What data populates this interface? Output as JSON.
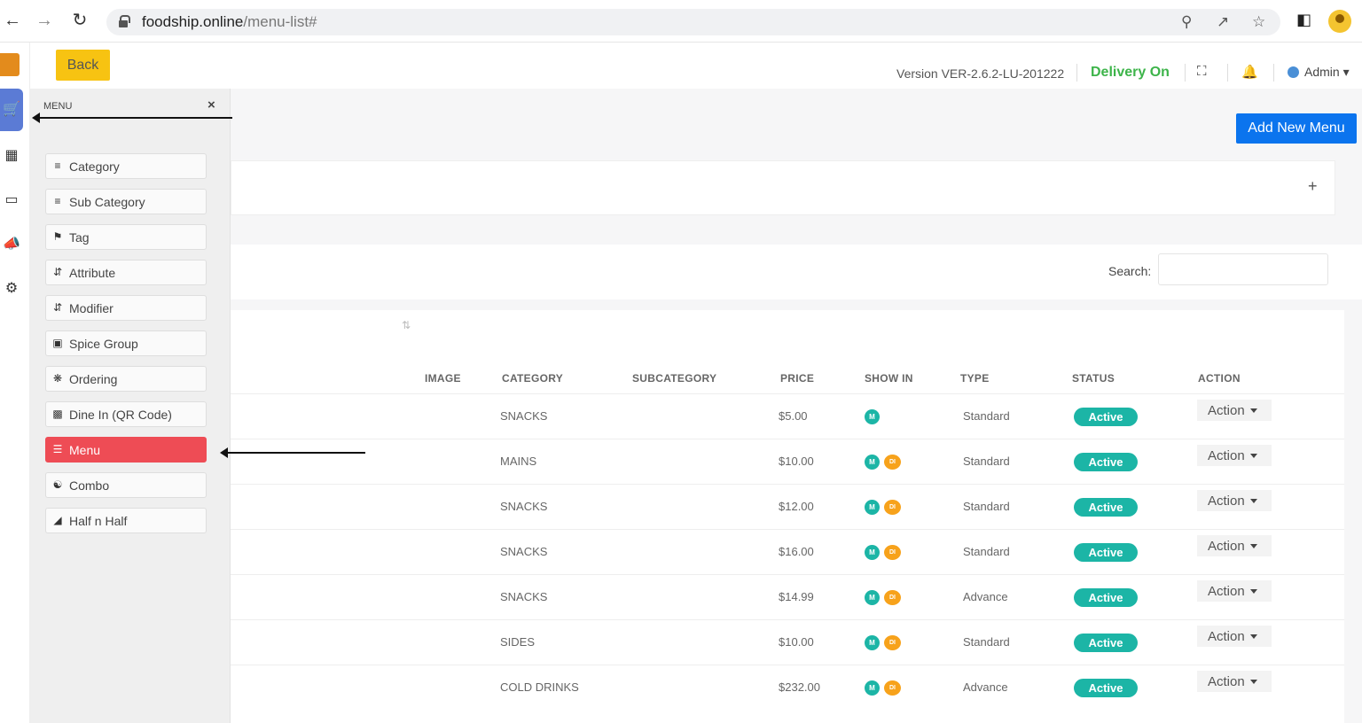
{
  "browser": {
    "url_host": "foodship.online",
    "url_path": "/menu-list#"
  },
  "header": {
    "back_label": "Back",
    "version": "Version VER-2.6.2-LU-201222",
    "delivery": "Delivery On",
    "admin": "Admin"
  },
  "menu_panel": {
    "title": "MENU",
    "close": "×",
    "items": [
      {
        "label": "Category",
        "icon": "list-icon"
      },
      {
        "label": "Sub Category",
        "icon": "list-icon"
      },
      {
        "label": "Tag",
        "icon": "tag-icon"
      },
      {
        "label": "Attribute",
        "icon": "sort-icon"
      },
      {
        "label": "Modifier",
        "icon": "sort-icon"
      },
      {
        "label": "Spice Group",
        "icon": "image-icon"
      },
      {
        "label": "Ordering",
        "icon": "gear-icon"
      },
      {
        "label": "Dine In (QR Code)",
        "icon": "qr-icon"
      },
      {
        "label": "Menu",
        "icon": "bars-icon"
      },
      {
        "label": "Combo",
        "icon": "combo-icon"
      },
      {
        "label": "Half n Half",
        "icon": "half-icon"
      }
    ]
  },
  "content": {
    "add_new_menu": "Add New Menu",
    "filter_plus": "+",
    "search_label": "Search:",
    "table": {
      "headers": [
        "IMAGE",
        "CATEGORY",
        "SUBCATEGORY",
        "PRICE",
        "SHOW IN",
        "TYPE",
        "STATUS",
        "ACTION"
      ],
      "badge_m": "M",
      "badge_di": "DI",
      "rows": [
        {
          "category": "SNACKS",
          "price": "$5.00",
          "type": "Standard",
          "status": "Active",
          "action": "Action",
          "di": false
        },
        {
          "category": "MAINS",
          "price": "$10.00",
          "type": "Standard",
          "status": "Active",
          "action": "Action",
          "di": true
        },
        {
          "category": "SNACKS",
          "price": "$12.00",
          "type": "Standard",
          "status": "Active",
          "action": "Action",
          "di": true
        },
        {
          "category": "SNACKS",
          "price": "$16.00",
          "type": "Standard",
          "status": "Active",
          "action": "Action",
          "di": true
        },
        {
          "category": "SNACKS",
          "price": "$14.99",
          "type": "Advance",
          "status": "Active",
          "action": "Action",
          "di": true
        },
        {
          "category": "SIDES",
          "price": "$10.00",
          "type": "Standard",
          "status": "Active",
          "action": "Action",
          "di": true
        },
        {
          "category": "COLD DRINKS",
          "price": "$232.00",
          "type": "Advance",
          "status": "Active",
          "action": "Action",
          "di": true
        }
      ]
    }
  },
  "colors": {
    "accent_blue": "#0b74ee",
    "menu_active": "#ee4c55",
    "status_green": "#1cb5a6",
    "delivery_green": "#3db44a",
    "back_yellow": "#f7c312"
  }
}
